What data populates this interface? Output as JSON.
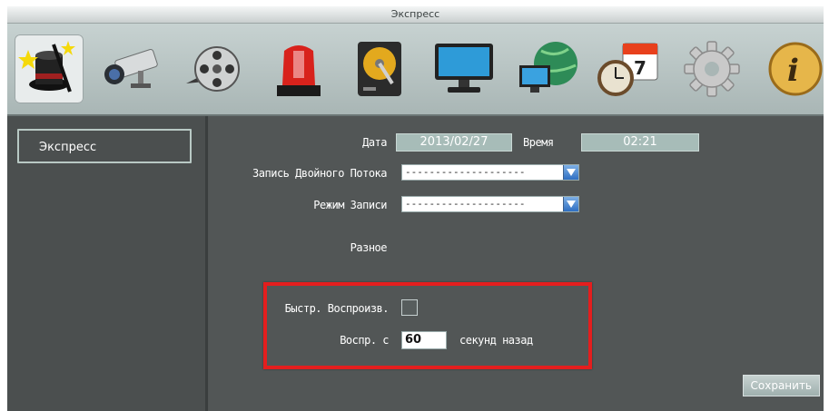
{
  "window": {
    "title": "Экспресс"
  },
  "toolbar": {
    "icons": [
      {
        "name": "express-wizard-icon"
      },
      {
        "name": "camera-icon"
      },
      {
        "name": "film-reel-icon"
      },
      {
        "name": "alarm-light-icon"
      },
      {
        "name": "hard-drive-icon"
      },
      {
        "name": "monitor-icon"
      },
      {
        "name": "network-icon"
      },
      {
        "name": "schedule-calendar-icon"
      },
      {
        "name": "settings-gear-icon"
      },
      {
        "name": "info-icon"
      }
    ]
  },
  "sidebar": {
    "items": [
      {
        "label": "Экспресс"
      }
    ]
  },
  "form": {
    "date_label": "Дата",
    "date_value": "2013/02/27",
    "time_label": "Время",
    "time_value": "02:21",
    "dual_stream_label": "Запись Двойного Потока",
    "dual_stream_value": "--------------------",
    "record_mode_label": "Режим Записи",
    "record_mode_value": "--------------------",
    "misc_label": "Разное",
    "quick_playback_label": "Быстр. Воспроизв.",
    "playback_from_label": "Воспр. с",
    "playback_from_value": "60",
    "seconds_ago_label": "секунд назад",
    "save_label": "Сохранить"
  },
  "colors": {
    "highlight": "#e41e1e",
    "value_box": "#a7bcb8",
    "panel": "#525656"
  }
}
